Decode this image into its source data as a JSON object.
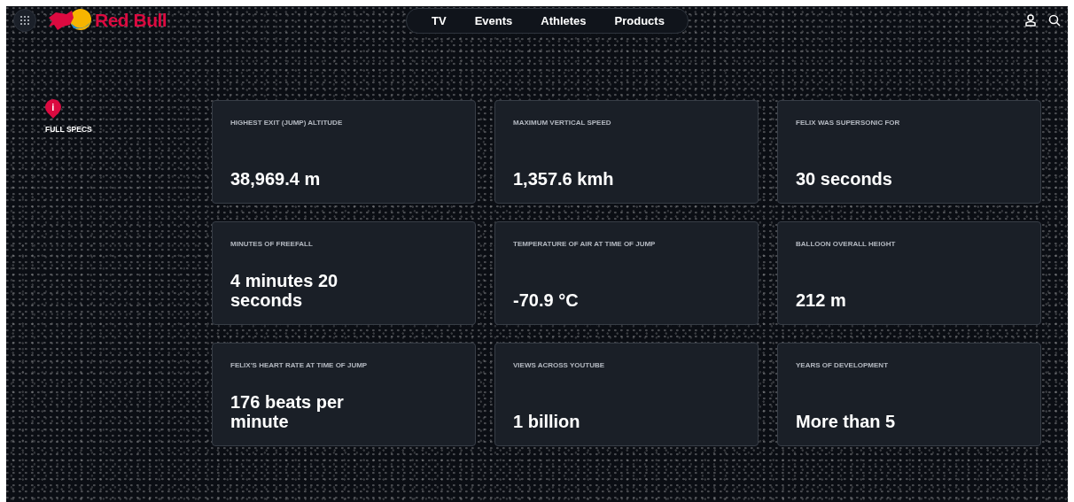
{
  "header": {
    "logo_text": "Red Bull",
    "nav": [
      {
        "label": "TV"
      },
      {
        "label": "Events"
      },
      {
        "label": "Athletes"
      },
      {
        "label": "Products"
      }
    ]
  },
  "sidebar": {
    "icon_text": "i",
    "label": "FULL SPECS"
  },
  "stats": [
    {
      "label": "HIGHEST EXIT (JUMP) ALTITUDE",
      "value": "38,969.4 m"
    },
    {
      "label": "MAXIMUM VERTICAL SPEED",
      "value": "1,357.6 kmh"
    },
    {
      "label": "FELIX WAS SUPERSONIC FOR",
      "value": "30 seconds"
    },
    {
      "label": "MINUTES OF FREEFALL",
      "value": "4 minutes 20 seconds"
    },
    {
      "label": "TEMPERATURE OF AIR AT TIME OF JUMP",
      "value": "-70.9 °C"
    },
    {
      "label": "BALLOON OVERALL HEIGHT",
      "value": "212 m"
    },
    {
      "label": "FELIX'S HEART RATE AT TIME OF JUMP",
      "value": "176 beats per minute"
    },
    {
      "label": "VIEWS ACROSS YOUTUBE",
      "value": "1 billion"
    },
    {
      "label": "YEARS OF DEVELOPMENT",
      "value": "More than 5"
    }
  ]
}
